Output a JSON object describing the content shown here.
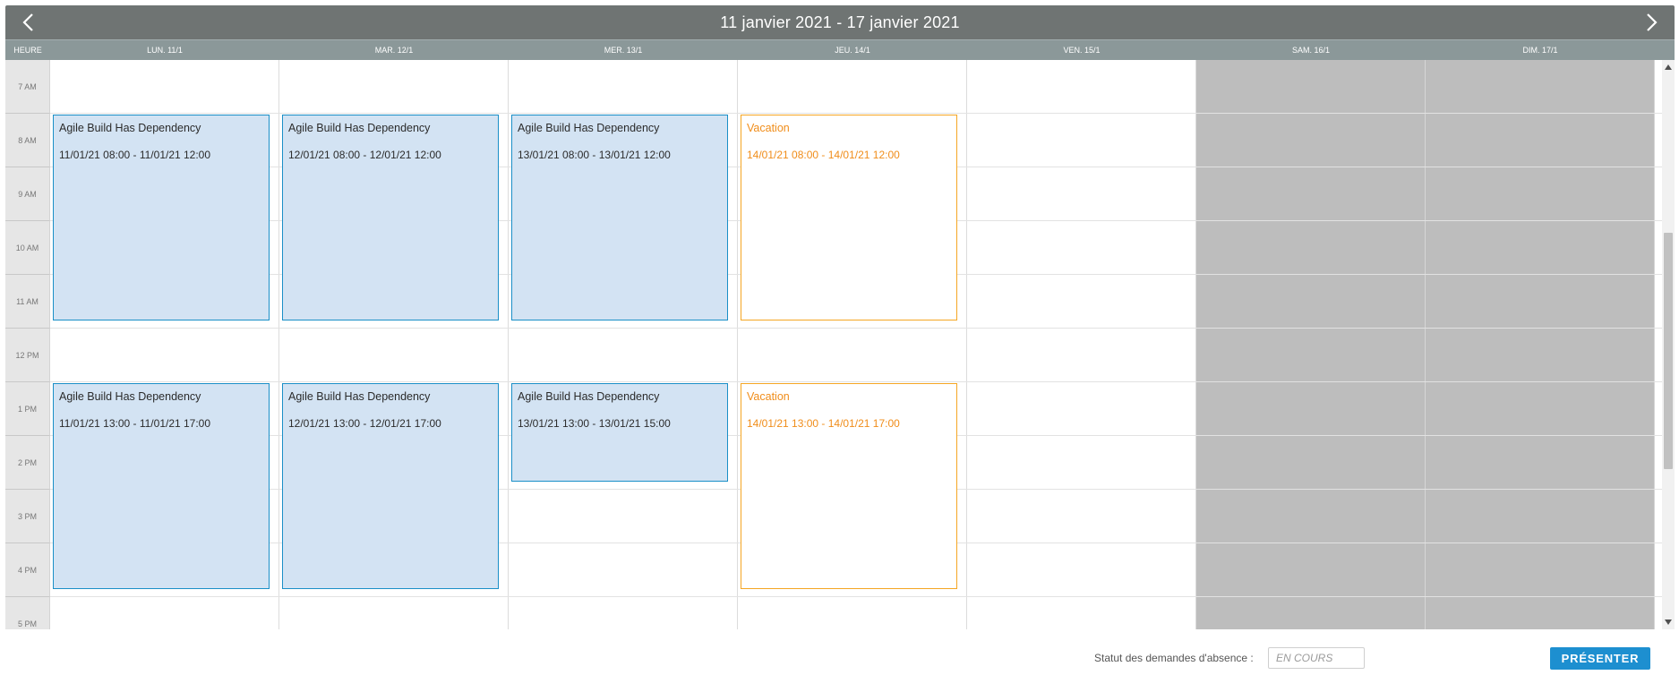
{
  "header": {
    "title": "11 janvier 2021 - 17 janvier 2021",
    "prev_icon": "chevron-left-icon",
    "next_icon": "chevron-right-icon",
    "color": "#6f7473"
  },
  "day_header": {
    "hour_label": "HEURE",
    "days": [
      "LUN. 11/1",
      "MAR. 12/1",
      "MER. 13/1",
      "JEU. 14/1",
      "VEN. 15/1",
      "SAM. 16/1",
      "DIM. 17/1"
    ]
  },
  "hours": [
    "7 AM",
    "8 AM",
    "9 AM",
    "10 AM",
    "11 AM",
    "12 PM",
    "1 PM",
    "2 PM",
    "3 PM",
    "4 PM",
    "5 PM"
  ],
  "weekend_days": [
    5,
    6
  ],
  "events": [
    {
      "day": 0,
      "start": 8,
      "end": 12,
      "type": "task",
      "title": "Agile Build Has Dependency",
      "time": "11/01/21 08:00 - 11/01/21 12:00"
    },
    {
      "day": 1,
      "start": 8,
      "end": 12,
      "type": "task",
      "title": "Agile Build Has Dependency",
      "time": "12/01/21 08:00 - 12/01/21 12:00"
    },
    {
      "day": 2,
      "start": 8,
      "end": 12,
      "type": "task",
      "title": "Agile Build Has Dependency",
      "time": "13/01/21 08:00 - 13/01/21 12:00"
    },
    {
      "day": 3,
      "start": 8,
      "end": 12,
      "type": "vacation",
      "title": "Vacation",
      "time": "14/01/21 08:00 - 14/01/21 12:00"
    },
    {
      "day": 0,
      "start": 13,
      "end": 17,
      "type": "task",
      "title": "Agile Build Has Dependency",
      "time": "11/01/21 13:00 - 11/01/21 17:00"
    },
    {
      "day": 1,
      "start": 13,
      "end": 17,
      "type": "task",
      "title": "Agile Build Has Dependency",
      "time": "12/01/21 13:00 - 12/01/21 17:00"
    },
    {
      "day": 2,
      "start": 13,
      "end": 15,
      "type": "task",
      "title": "Agile Build Has Dependency",
      "time": "13/01/21 13:00 - 13/01/21 15:00"
    },
    {
      "day": 3,
      "start": 13,
      "end": 17,
      "type": "vacation",
      "title": "Vacation",
      "time": "14/01/21 13:00 - 14/01/21 17:00"
    }
  ],
  "colors": {
    "task_border": "#1a8fc7",
    "task_fill": "#d3e3f3",
    "vacation_border": "#f5a623",
    "vacation_text": "#f08d1a",
    "weekend_fill": "#bdbdbd",
    "button": "#1d8fd0"
  },
  "footer": {
    "status_label": "Statut des demandes d'absence :",
    "status_placeholder": "EN COURS",
    "submit_label": "PRÉSENTER"
  }
}
